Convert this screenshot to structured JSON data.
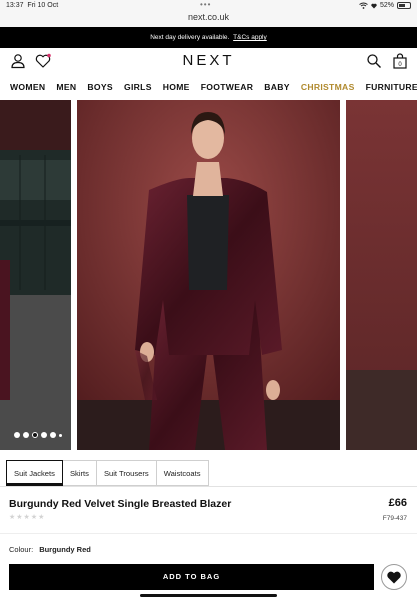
{
  "status_bar": {
    "time": "13:37",
    "day": "Fri 10 Oct",
    "url": "next.co.uk",
    "dots": "•••",
    "battery": "52%"
  },
  "promo": {
    "text": "Next day delivery available.",
    "link": "T&Cs apply"
  },
  "header": {
    "logo": "NEXT",
    "bag_count": "0"
  },
  "nav": [
    "WOMEN",
    "MEN",
    "BOYS",
    "GIRLS",
    "HOME",
    "FOOTWEAR",
    "BABY",
    "CHRISTMAS",
    "FURNITURE"
  ],
  "nav_accent": "#b08a2e",
  "gallery": {
    "image_count": 6,
    "active_index": 2
  },
  "tabs": [
    "Suit Jackets",
    "Skirts",
    "Suit Trousers",
    "Waistcoats"
  ],
  "product": {
    "title": "Burgundy Red Velvet Single Breasted Blazer",
    "price": "£66",
    "code": "F79-437",
    "rating": 0,
    "stars": "★★★★★",
    "colour_label": "Colour:",
    "colour_value": "Burgundy Red"
  },
  "actions": {
    "add_to_bag": "ADD TO BAG"
  },
  "colors": {
    "garment": "#4a1420",
    "backdrop": "#6b2a2c"
  }
}
